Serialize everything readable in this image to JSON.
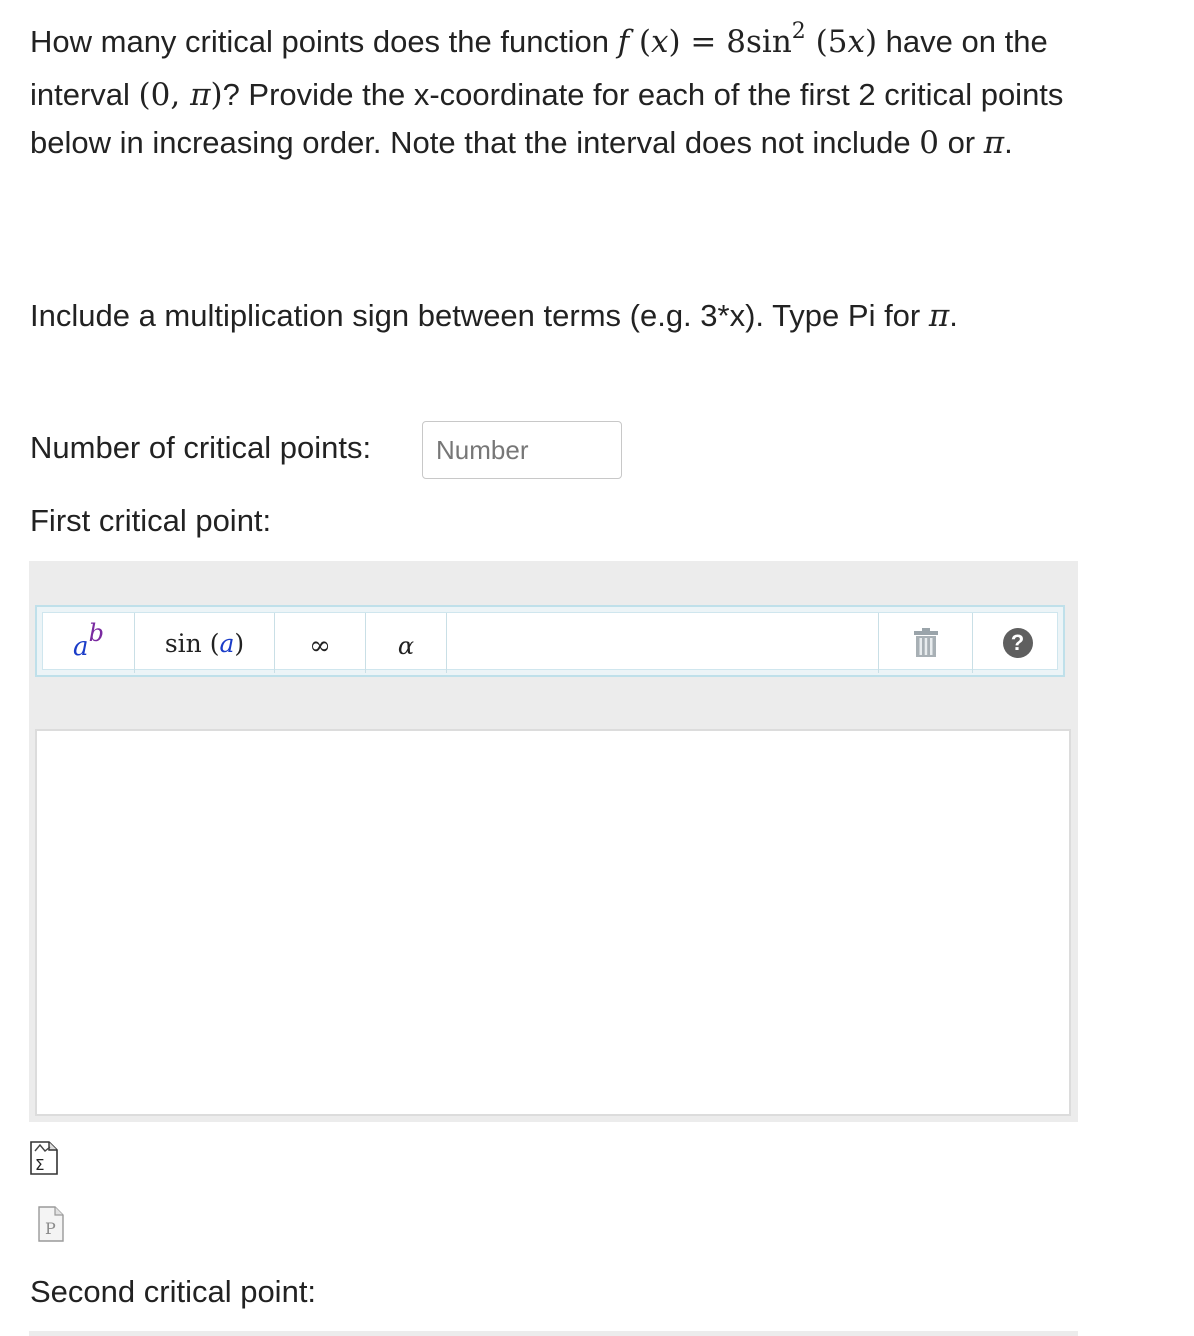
{
  "question": {
    "t1": "How many critical points does the function ",
    "f": "f",
    "lp": " (",
    "x": "x",
    "rp_eq": ") = ",
    "coef": "8",
    "sin": "sin",
    "sup2": "2",
    "arg_open": " (5",
    "arg_x": "x",
    "arg_close": ")",
    "t2": " have on the interval ",
    "interval_open": "(0, ",
    "pi1": "π",
    "interval_close": ")",
    "t3": "? Provide the x-coordinate for each of the first 2 critical points below in increasing order. Note that the interval does not include ",
    "zero": "0",
    "t4": " or ",
    "pi2": "π",
    "t5": "."
  },
  "instruction": {
    "text": "Include a multiplication sign between terms (e.g. 3*x). Type Pi for ",
    "pi": "π",
    "end": "."
  },
  "fields": {
    "num_label": "Number of critical points:",
    "num_placeholder": "Number",
    "first_label": "First critical point:",
    "second_label": "Second critical point:"
  },
  "toolbar": {
    "power_base": "a",
    "power_exp": "b",
    "sin_fn": "sin",
    "sin_arg_open": " (",
    "sin_arg": "a",
    "sin_arg_close": ")",
    "infinity": "∞",
    "alpha": "α",
    "help": "?"
  },
  "colors": {
    "accent_border": "#bfe0ea",
    "panel_bg": "#ececec",
    "var_blue": "#1a3cc8",
    "exp_purple": "#7a2aa0"
  },
  "icons": [
    "power-template-icon",
    "sin-template-icon",
    "infinity-icon",
    "alpha-icon",
    "trash-icon",
    "help-icon",
    "sigma-doc-icon",
    "doc-icon"
  ]
}
